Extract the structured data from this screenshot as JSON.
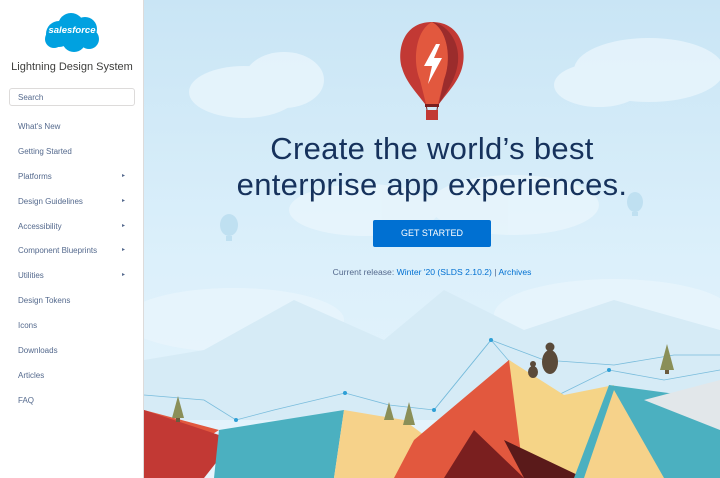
{
  "sidebar": {
    "logo_text": "salesforce",
    "title": "Lightning Design System",
    "search_placeholder": "Search",
    "items": [
      {
        "label": "What's New",
        "has_submenu": false
      },
      {
        "label": "Getting Started",
        "has_submenu": false
      },
      {
        "label": "Platforms",
        "has_submenu": true
      },
      {
        "label": "Design Guidelines",
        "has_submenu": true
      },
      {
        "label": "Accessibility",
        "has_submenu": true
      },
      {
        "label": "Component Blueprints",
        "has_submenu": true
      },
      {
        "label": "Utilities",
        "has_submenu": true
      },
      {
        "label": "Design Tokens",
        "has_submenu": false
      },
      {
        "label": "Icons",
        "has_submenu": false
      },
      {
        "label": "Downloads",
        "has_submenu": false
      },
      {
        "label": "Articles",
        "has_submenu": false
      },
      {
        "label": "FAQ",
        "has_submenu": false
      }
    ],
    "submenu_glyph": "▸"
  },
  "hero": {
    "headline_line1": "Create the world’s best",
    "headline_line2": "enterprise app experiences.",
    "cta_label": "GET STARTED",
    "release_prefix": "Current release:",
    "release_link": "Winter '20 (SLDS 2.10.2)",
    "separator": "|",
    "archives_link": "Archives"
  },
  "colors": {
    "brand_blue": "#0070d2",
    "logo_blue": "#00a1e0",
    "headline": "#16325c",
    "nav_text": "#54698d",
    "sky": "#c9e5f5"
  },
  "icons": [
    "salesforce-cloud-logo",
    "hot-air-balloon-lightning",
    "chevron-right-icon"
  ]
}
